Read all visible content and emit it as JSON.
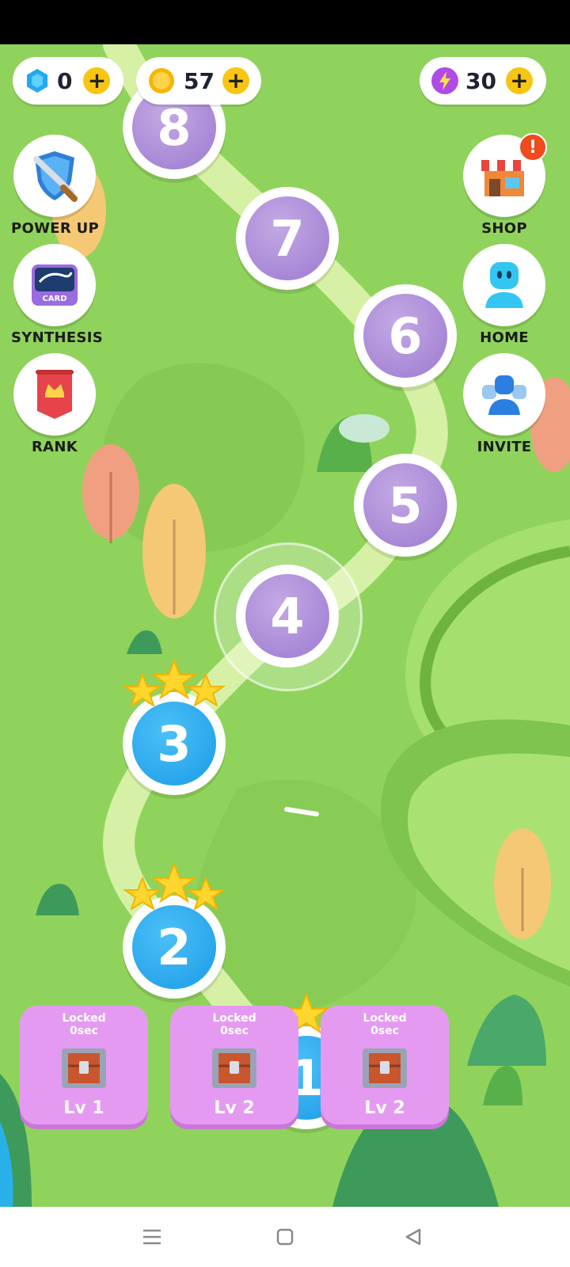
{
  "hud": {
    "gems": "0",
    "coins": "57",
    "energy": "30",
    "plus": "+"
  },
  "side_left": [
    {
      "label": "POWER UP",
      "icon": "sword-shield-icon"
    },
    {
      "label": "SYNTHESIS",
      "icon": "card-icon",
      "icon_text": "CARD"
    },
    {
      "label": "RANK",
      "icon": "crown-banner-icon"
    }
  ],
  "side_right": [
    {
      "label": "SHOP",
      "icon": "shop-icon",
      "badge": "!"
    },
    {
      "label": "HOME",
      "icon": "robot-icon"
    },
    {
      "label": "INVITE",
      "icon": "friends-icon"
    }
  ],
  "levels": [
    {
      "num": "8",
      "state": "locked"
    },
    {
      "num": "7",
      "state": "locked"
    },
    {
      "num": "6",
      "state": "locked"
    },
    {
      "num": "5",
      "state": "locked"
    },
    {
      "num": "4",
      "state": "current"
    },
    {
      "num": "3",
      "state": "completed",
      "stars": 3
    },
    {
      "num": "2",
      "state": "completed",
      "stars": 3
    },
    {
      "num": "1",
      "state": "completed",
      "stars": 3
    }
  ],
  "chests": [
    {
      "status": "Locked",
      "time": "0sec",
      "level": "Lv 1"
    },
    {
      "status": "Locked",
      "time": "0sec",
      "level": "Lv 2"
    },
    {
      "status": "Locked",
      "time": "0sec",
      "level": "Lv 2"
    }
  ],
  "colors": {
    "grass": "#8fd25a",
    "path": "#d9f3a6",
    "locked_level": "#a888d6",
    "completed_level": "#1a9be6",
    "chest_card": "#e59af2",
    "plus_button": "#f7c514"
  },
  "navbar": {
    "buttons": [
      "menu-icon",
      "home-square-icon",
      "back-triangle-icon"
    ]
  }
}
